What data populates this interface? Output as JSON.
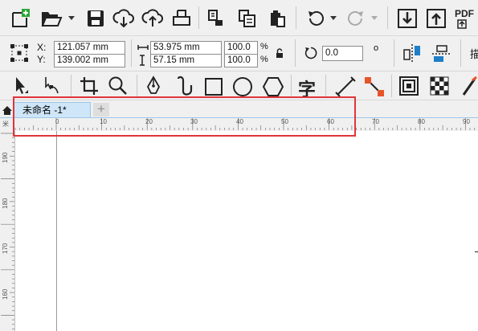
{
  "toolbar_standard": {
    "icons": [
      "new-document-icon",
      "open-folder-icon",
      "save-icon",
      "import-cloud-icon",
      "export-cloud-icon",
      "print-icon",
      "copy-page-icon",
      "paste-page-icon",
      "clipboard-icon",
      "undo-icon",
      "redo-icon",
      "import-icon",
      "export-icon",
      "pdf-export-icon"
    ],
    "pdf_label": "PDF"
  },
  "property_bar": {
    "x_label": "X:",
    "y_label": "Y:",
    "x_value": "121.057 mm",
    "y_value": "139.002 mm",
    "width_value": "53.975 mm",
    "height_value": "57.15 mm",
    "scale_x": "100.0",
    "scale_y": "100.0",
    "percent_symbol": "%",
    "rotation_value": "0.0",
    "degree_symbol": "o",
    "truncated_label": "描"
  },
  "toolbox": {
    "tools": [
      "pick-tool",
      "shape-tool",
      "crop-tool",
      "zoom-tool",
      "pen-tool",
      "artistic-media-tool",
      "rectangle-tool",
      "ellipse-tool",
      "polygon-tool",
      "text-tool",
      "dimension-tool",
      "connector-tool",
      "shadow-tool",
      "transparency-tool",
      "eyedropper-tool"
    ],
    "text_tool_glyph": "字"
  },
  "document": {
    "tab_title": "未命名 -1*",
    "add_tab_symbol": "+"
  },
  "rulers": {
    "horizontal_numbers": [
      "0",
      "10",
      "20",
      "30",
      "40",
      "50",
      "60",
      "70",
      "80",
      "90"
    ],
    "vertical_numbers": [
      "190",
      "180",
      "170",
      "160"
    ],
    "corner_label": "米"
  },
  "colors": {
    "toolbar_bg": "#f0f0f0",
    "tab_active_bg": "#cfe6f8",
    "highlight_border": "#e0353a",
    "canvas_bg": "#ffffff"
  }
}
